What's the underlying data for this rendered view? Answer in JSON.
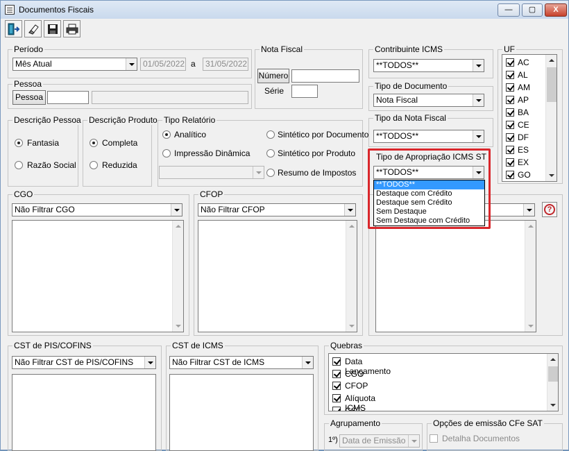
{
  "window": {
    "title": "Documentos Fiscais",
    "minimize_glyph": "—",
    "maximize_glyph": "▢",
    "close_glyph": "X"
  },
  "toolbar": {
    "icons": [
      "exit-door-icon",
      "eraser-icon",
      "save-disk-icon",
      "printer-icon"
    ]
  },
  "periodo": {
    "legend": "Período",
    "selected": "Mês Atual",
    "date_from": "01/05/2022",
    "separator": "a",
    "date_to": "31/05/2022"
  },
  "nota_fiscal": {
    "legend": "Nota Fiscal",
    "numero_button": "Número",
    "serie_label": "Série",
    "numero_value": "",
    "serie_value": ""
  },
  "pessoa": {
    "legend": "Pessoa",
    "button": "Pessoa",
    "code_value": "",
    "name_value": ""
  },
  "contribuinte_icms": {
    "legend": "Contribuinte ICMS",
    "selected": "**TODOS**"
  },
  "tipo_documento": {
    "legend": "Tipo de Documento",
    "selected": "Nota Fiscal"
  },
  "tipo_nota_fiscal": {
    "legend": "Tipo da Nota Fiscal",
    "selected": "**TODOS**"
  },
  "tipo_apropriacao": {
    "legend": "Tipo de Apropriação ICMS ST",
    "selected": "**TODOS**",
    "options": [
      "**TODOS**",
      "Destaque com Crédito",
      "Destaque sem Crédito",
      "Sem Destaque",
      "Sem Destaque com Crédito"
    ],
    "highlight_color": "#d9262b"
  },
  "uf": {
    "legend": "UF",
    "items": [
      {
        "label": "AC",
        "checked": true
      },
      {
        "label": "AL",
        "checked": true
      },
      {
        "label": "AM",
        "checked": true
      },
      {
        "label": "AP",
        "checked": true
      },
      {
        "label": "BA",
        "checked": true
      },
      {
        "label": "CE",
        "checked": true
      },
      {
        "label": "DF",
        "checked": true
      },
      {
        "label": "ES",
        "checked": true
      },
      {
        "label": "EX",
        "checked": true
      },
      {
        "label": "GO",
        "checked": true
      }
    ]
  },
  "descricao_pessoa": {
    "legend": "Descrição Pessoa",
    "options": [
      {
        "label": "Fantasia",
        "selected": true
      },
      {
        "label": "Razão Social",
        "selected": false
      }
    ]
  },
  "descricao_produto": {
    "legend": "Descrição Produto",
    "options": [
      {
        "label": "Completa",
        "selected": true
      },
      {
        "label": "Reduzida",
        "selected": false
      }
    ]
  },
  "tipo_relatorio": {
    "legend": "Tipo Relatório",
    "options": [
      {
        "label": "Analítico",
        "selected": true
      },
      {
        "label": "Sintético por Documento",
        "selected": false
      },
      {
        "label": "Impressão Dinâmica",
        "selected": false
      },
      {
        "label": "Sintético por Produto",
        "selected": false
      },
      {
        "label": "Resumo de Impostos",
        "selected": false
      }
    ],
    "layout_select": ""
  },
  "cgo": {
    "legend": "CGO",
    "selected": "Não Filtrar CGO"
  },
  "cfop": {
    "legend": "CFOP",
    "selected": "Não Filtrar CFOP"
  },
  "third_filter": {
    "help_glyph": "?"
  },
  "cst_pis": {
    "legend": "CST de PIS/COFINS",
    "selected": "Não Filtrar CST de PIS/COFINS"
  },
  "cst_icms": {
    "legend": "CST de ICMS",
    "selected": "Não Filtrar CST de ICMS"
  },
  "quebras": {
    "legend": "Quebras",
    "items": [
      {
        "label": "Data Lançamento",
        "checked": true
      },
      {
        "label": "CGO",
        "checked": true
      },
      {
        "label": "CFOP",
        "checked": true
      },
      {
        "label": "Alíquota ICMS",
        "checked": true
      },
      {
        "label": "CST de ICMS",
        "checked": true
      }
    ]
  },
  "agrupamento": {
    "legend": "Agrupamento",
    "prefix": "1º)",
    "selected": "Data de Emissão"
  },
  "cfe_sat": {
    "legend": "Opções de emissão CFe SAT",
    "detalha_label": "Detalha Documentos",
    "detalha_checked": false
  }
}
